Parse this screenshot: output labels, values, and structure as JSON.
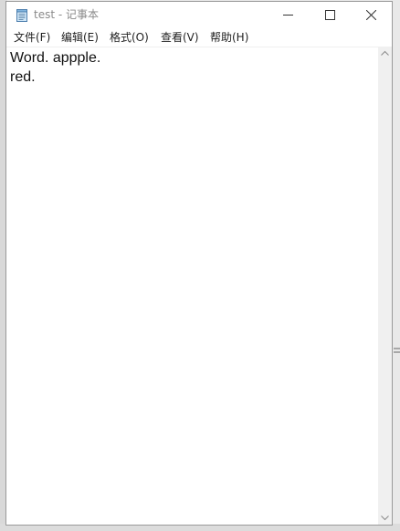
{
  "window": {
    "title": "test - 记事本"
  },
  "menu": {
    "items": [
      {
        "label": "文件(F)"
      },
      {
        "label": "编辑(E)"
      },
      {
        "label": "格式(O)"
      },
      {
        "label": "查看(V)"
      },
      {
        "label": "帮助(H)"
      }
    ]
  },
  "editor": {
    "lines": [
      "Word. appple.",
      "red."
    ]
  },
  "icons": {
    "app": "notepad-icon",
    "minimize": "minimize-icon",
    "maximize": "maximize-icon",
    "close": "close-icon",
    "scroll_up": "chevron-up-icon",
    "scroll_down": "chevron-down-icon"
  },
  "colors": {
    "title_text": "#8a8a8a",
    "menu_text": "#1f1f1f",
    "editor_text": "#111111",
    "scrollbar_track": "#f0f0f0"
  }
}
